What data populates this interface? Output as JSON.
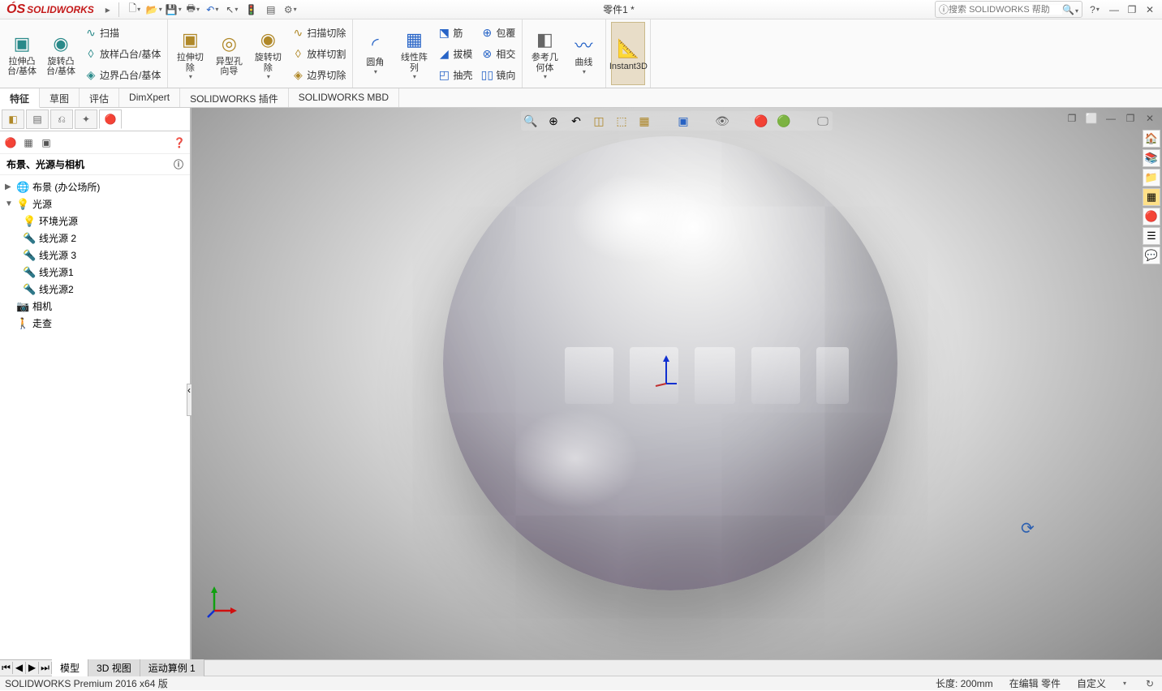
{
  "title_bar": {
    "app_name": "SOLIDWORKS",
    "document_title": "零件1 *",
    "search_placeholder": "搜索 SOLIDWORKS 帮助"
  },
  "ribbon": {
    "r1": {
      "extrude_boss": "拉伸凸台/基体",
      "revolve_boss": "旋转凸台/基体",
      "sweep": "扫描",
      "loft": "放样凸台/基体",
      "boundary": "边界凸台/基体"
    },
    "r2": {
      "extrude_cut": "拉伸切除",
      "hole_wizard": "异型孔向导",
      "revolve_cut": "旋转切除",
      "sweep_cut": "扫描切除",
      "loft_cut": "放样切割",
      "boundary_cut": "边界切除"
    },
    "r3": {
      "fillet": "圆角",
      "linear_pattern": "线性阵列",
      "rib": "筋",
      "draft": "拔模",
      "shell": "抽壳",
      "wrap": "包覆",
      "intersect": "相交",
      "mirror": "镜向"
    },
    "r4": {
      "ref_geom": "参考几何体",
      "curves": "曲线"
    },
    "r5": {
      "instant3d": "Instant3D"
    }
  },
  "command_tabs": [
    "特征",
    "草图",
    "评估",
    "DimXpert",
    "SOLIDWORKS 插件",
    "SOLIDWORKS MBD"
  ],
  "side_panel": {
    "header": "布景、光源与相机",
    "scene": "布景 (办公场所)",
    "light_root": "光源",
    "lights": [
      "环境光源",
      "线光源 2",
      "线光源 3",
      "线光源1",
      "线光源2"
    ],
    "camera": "相机",
    "walkthrough": "走查"
  },
  "bottom_tabs": [
    "模型",
    "3D 视图",
    "运动算例 1"
  ],
  "status_bar": {
    "product": "SOLIDWORKS Premium 2016 x64 版",
    "length": "长度: 200mm",
    "editing": "在编辑 零件",
    "custom": "自定义"
  }
}
